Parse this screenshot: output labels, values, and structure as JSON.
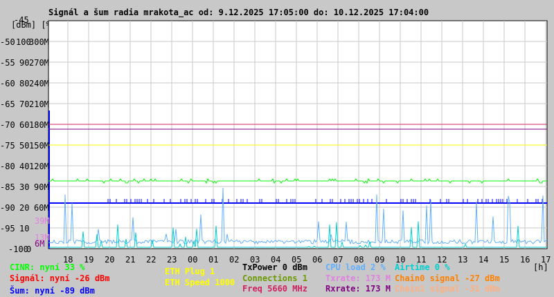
{
  "chart_data": {
    "type": "line",
    "title": "Signál a šum radia mrakota_ac od: 9.12.2025 17:05:00 do: 10.12.2025 17:04:00",
    "ylabel": "[dBm] [%]",
    "xlabel": "[h]",
    "ylim_dbm": [
      -100,
      -45
    ],
    "y_ticks_dbm": [
      "-45",
      "-50",
      "-55",
      "-60",
      "-65",
      "-70",
      "-75",
      "-80",
      "-85",
      "-90",
      "-95",
      "-100"
    ],
    "y_ticks_pct": [
      "100",
      "90",
      "80",
      "70",
      "60",
      "50",
      "40",
      "30",
      "20",
      "10",
      "0"
    ],
    "y_ticks_rate": [
      "300M",
      "270M",
      "240M",
      "210M",
      "180M",
      "150M",
      "120M",
      "90M",
      "60M"
    ],
    "rate_markers": [
      {
        "label": "39M",
        "color": "#e080e0"
      },
      {
        "label": "13M",
        "color": "#e080e0"
      },
      {
        "label": "6M",
        "color": "#800080"
      }
    ],
    "x_ticks": [
      "18",
      "19",
      "20",
      "21",
      "22",
      "23",
      "00",
      "01",
      "02",
      "03",
      "04",
      "05",
      "06",
      "07",
      "08",
      "09",
      "10",
      "11",
      "12",
      "13",
      "14",
      "15",
      "16",
      "17"
    ],
    "series": [
      {
        "name": "Freq",
        "value_dbm": -70,
        "color": "#d02060"
      },
      {
        "name": "Rxrate",
        "value_M": 173,
        "color": "#800080"
      },
      {
        "name": "ETH Speed",
        "value_dbm": -75,
        "color": "#ffff00"
      },
      {
        "name": "CINR",
        "value_dbm": -83.5,
        "color": "#00ff00"
      },
      {
        "name": "Šum",
        "value_dbm": -89,
        "color": "#0000ff"
      },
      {
        "name": "CPU load",
        "value_dbm": -99,
        "color": "#60b0ff"
      },
      {
        "name": "Airtime",
        "value_dbm": -100,
        "color": "#00d0d0"
      }
    ]
  },
  "legend": [
    {
      "text": "CINR: nyní 33 %",
      "color": "#00ff00"
    },
    {
      "text": "Signál: nyní -26 dBm",
      "color": "#ff0000"
    },
    {
      "text": "Šum: nyní -89 dBm",
      "color": "#0000ff"
    },
    {
      "text": "ETH Plug 1",
      "color": "#ffff00"
    },
    {
      "text": "ETH Speed 1000",
      "color": "#ffff00"
    },
    {
      "text": "TxPower 0 dBm",
      "color": "#000000"
    },
    {
      "text": "Connections 1",
      "color": "#6a9a00"
    },
    {
      "text": "Freq 5660 MHz",
      "color": "#d02060"
    },
    {
      "text": "CPU load 2 %",
      "color": "#60b0ff"
    },
    {
      "text": "Txrate: 173 M",
      "color": "#e080e0"
    },
    {
      "text": "Rxrate: 173 M",
      "color": "#800080"
    },
    {
      "text": "Airtime 0 %",
      "color": "#00d0d0"
    },
    {
      "text": "Chain0 signal -27 dBm",
      "color": "#ff8000"
    },
    {
      "text": "Chain1 signal -31 dBm",
      "color": "#ffb080"
    }
  ]
}
